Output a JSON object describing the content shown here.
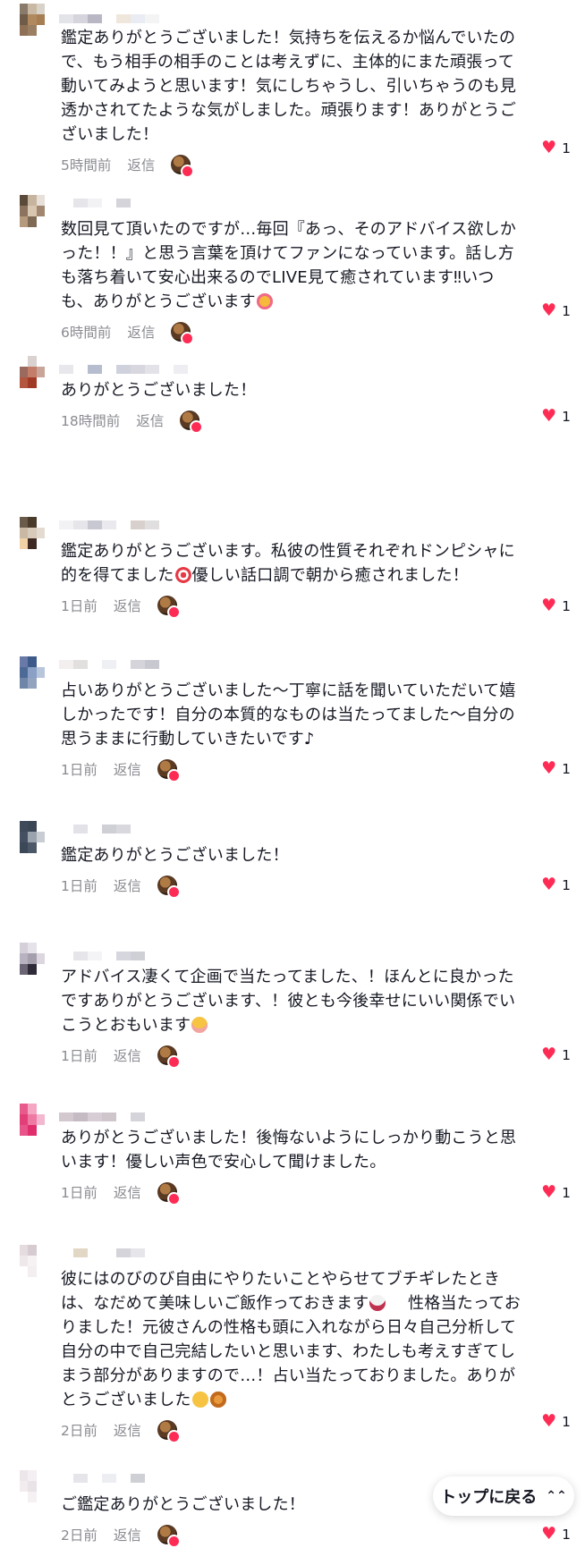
{
  "comments": [
    {
      "text": "鑑定ありがとうございました！気持ちを伝えるか悩んでいたので、もう相手の相手のことは考えずに、主体的にまた頑張って動いてみようと思います！気にしちゃうし、引いちゃうのも見透かされてたような気がしました。頑張ります！ありがとうございました！",
      "time": "5時間前",
      "reply": "返信",
      "likes": "1"
    },
    {
      "text": "数回見て頂いたのですが…毎回『あっ、そのアドバイス欲しかった！！』と思う言葉を頂けてファンになっています。話し方も落ち着いて安心出来るのでLIVE見て癒されています‼︎いつも、ありがとうございます",
      "time": "6時間前",
      "reply": "返信",
      "likes": "1"
    },
    {
      "text": "ありがとうございました！",
      "time": "18時間前",
      "reply": "返信",
      "likes": "1"
    },
    {
      "text": "鑑定ありがとうございます。私彼の性質それぞれドンピシャに的を得てました",
      "text2": "優しい話口調で朝から癒されました！",
      "time": "1日前",
      "reply": "返信",
      "likes": "1"
    },
    {
      "text": "占いありがとうございました〜丁寧に話を聞いていただいて嬉しかったです！自分の本質的なものは当たってました〜自分の思うままに行動していきたいです♪",
      "time": "1日前",
      "reply": "返信",
      "likes": "1"
    },
    {
      "text": "鑑定ありがとうございました！",
      "time": "1日前",
      "reply": "返信",
      "likes": "1"
    },
    {
      "text": "アドバイス凄くて企画で当たってました、！ほんとに良かったですありがとうございます、！彼とも今後幸せにいい関係でいこうとおもいます",
      "time": "1日前",
      "reply": "返信",
      "likes": "1"
    },
    {
      "text": "ありがとうございました！後悔ないようにしっかり動こうと思います！優しい声色で安心して聞けました。",
      "time": "1日前",
      "reply": "返信",
      "likes": "1"
    },
    {
      "text": "彼にはのびのび自由にやりたいことやらせてブチギレたときは、なだめて美味しいご飯作っておきます",
      "text2": "性格当たっておりました！元彼さんの性格も頭に入れながら日々自己分析して自分の中で自己完結したいと思います、わたしも考えすぎてしまう部分がありますので…！占い当たっておりました。ありがとうございました",
      "time": "2日前",
      "reply": "返信",
      "likes": "1"
    },
    {
      "text": "ご鑑定ありがとうございました！",
      "time": "2日前",
      "reply": "返信",
      "likes": "1"
    }
  ],
  "back_to_top": "トップに戻る",
  "back_to_top_icon": "chevron-up-double-icon",
  "colors": {
    "like": "#fe2c55",
    "meta": "#8a8b91",
    "text": "#161823"
  }
}
